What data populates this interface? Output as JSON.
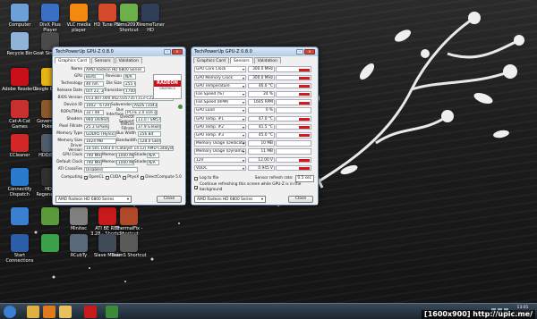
{
  "desktop_icons": [
    {
      "label": "Computer",
      "icon": "computer-icon",
      "color": "#6ea0d8"
    },
    {
      "label": "DivX Plus Player",
      "icon": "divx-icon",
      "color": "#3a6fc4"
    },
    {
      "label": "VLC media player",
      "icon": "vlc-icon",
      "color": "#f28a12"
    },
    {
      "label": "HD Tune Pro",
      "icon": "hdtune-icon",
      "color": "#d44a2a"
    },
    {
      "label": "Sims2097 - Shortcut",
      "icon": "sims-icon",
      "color": "#6bb04a"
    },
    {
      "label": "XtremeTuner HD",
      "icon": "xtremetuner-icon",
      "color": "#2f3f58"
    },
    {
      "label": "Recycle Bin",
      "icon": "recycle-bin-icon",
      "color": "#8fb4d8"
    },
    {
      "label": "Goat Simulator",
      "icon": "goat-icon",
      "color": "#4a4a4a"
    },
    {
      "label": "Adobe Reader 9",
      "icon": "adobe-reader-icon",
      "color": "#c8101a"
    },
    {
      "label": "Google Chrome",
      "icon": "chrome-icon",
      "color": "#e7b416"
    },
    {
      "label": "Cat-A-Cat Games",
      "icon": "cat-games-icon",
      "color": "#c83030"
    },
    {
      "label": "Governor of Poker 2",
      "icon": "poker-icon",
      "color": "#8a5a2a"
    },
    {
      "label": "CCleaner",
      "icon": "ccleaner-icon",
      "color": "#d02828"
    },
    {
      "label": "HDD/Deck",
      "icon": "hdd-icon",
      "color": "#505c6a"
    },
    {
      "label": "ConnectIfy Dispatch",
      "icon": "connectify-icon",
      "color": "#2a7bd0"
    },
    {
      "label": "HDD Regenerator",
      "icon": "hdd-regenerator-icon",
      "color": "#303030"
    },
    {
      "label": "",
      "icon": "app-icon",
      "color": "#3a7fd0"
    },
    {
      "label": "",
      "icon": "app-icon",
      "color": "#5a9a3a"
    },
    {
      "label": "Minitec",
      "icon": "minitec-icon",
      "color": "#808080"
    },
    {
      "label": "ATI BE RBE 3.28 - Shortcut",
      "icon": "ati-icon",
      "color": "#c81a1a"
    },
    {
      "label": "ThermalFix - Shortcut",
      "icon": "thermal-icon",
      "color": "#b04a2a"
    },
    {
      "label": "Start Connections",
      "icon": "network-icon",
      "color": "#2a5fa8"
    },
    {
      "label": "",
      "icon": "app-icon",
      "color": "#3aa04a"
    },
    {
      "label": "RCubTy",
      "icon": "rcub-icon",
      "color": "#5a6a7a"
    },
    {
      "label": "Slave Movie",
      "icon": "slave-movie-icon",
      "color": "#404a58"
    },
    {
      "label": "TeamS Shortcut",
      "icon": "teams-icon",
      "color": "#5a5a5a"
    }
  ],
  "window1": {
    "title": "TechPowerUp GPU-Z 0.8.0",
    "tabs": [
      "Graphics Card",
      "Sensors",
      "Validation"
    ],
    "active_tab": 0,
    "fields": {
      "name": "AMD Radeon HD 6800 Series",
      "gpu": "Barts",
      "revision": "N/A",
      "technology": "40 nm",
      "die_size": "255 mm²",
      "release_date": "Oct 22, 2010",
      "transistors": "1700M",
      "bios_version": "013.007.000.002.035735 (113-C2230100-102)",
      "device_id": "1002 - 6739",
      "subvendor": "ASUS (1043)",
      "rops_tmus": "32 / 48",
      "bus_interface": "PCI-E 2.0 x16 @ x16 1.1",
      "shaders": "960 Unified",
      "directx_support": "11.0 / SM5.0",
      "pixel_fillrate": "25.3 GPixel/s",
      "texture_fillrate": "37.9 GTexel/s",
      "memory_type": "GDDR5 (Hynix)",
      "bus_width": "256 Bit",
      "memory_size": "1024 MB",
      "bandwidth": "128.0 GB/s",
      "driver_version": "14.501.1003.0 (Catalyst 14.12) AMD Catalyst Omega Software",
      "gpu_clock": "790 MHz",
      "memory_clock": "1000 MHz",
      "shader_clock": "N/A",
      "default_clock": "790 MHz",
      "default_memory": "1000 MHz",
      "default_shader": "N/A",
      "crossfire": "Disabled",
      "computing": [
        "OpenCL",
        "CUDA",
        "PhysX",
        "DirectCompute 5.0"
      ],
      "computing_checked": [
        true,
        false,
        false,
        true
      ]
    },
    "labels": {
      "name": "Name",
      "gpu": "GPU",
      "revision": "Revision",
      "technology": "Technology",
      "die_size": "Die Size",
      "release_date": "Release Date",
      "transistors": "Transistors",
      "bios_version": "BIOS Version",
      "device_id": "Device ID",
      "subvendor": "Subvendor",
      "rops_tmus": "ROPs/TMUs",
      "bus_interface": "Bus Interface",
      "shaders": "Shaders",
      "directx_support": "DirectX Support",
      "pixel_fillrate": "Pixel Fillrate",
      "texture_fillrate": "Texture Fillrate",
      "memory_type": "Memory Type",
      "bus_width": "Bus Width",
      "memory_size": "Memory Size",
      "bandwidth": "Bandwidth",
      "driver_version": "Driver Version",
      "gpu_clock": "GPU Clock",
      "memory": "Memory",
      "shader": "Shader",
      "default_clock": "Default Clock",
      "crossfire": "ATI CrossFire",
      "computing": "Computing"
    },
    "logo_text": "RADEON",
    "logo_sub": "GRAPHICS",
    "card_select": "AMD Radeon HD 6800 Series",
    "close_label": "Close"
  },
  "window2": {
    "title": "TechPowerUp GPU-Z 0.8.0",
    "tabs": [
      "Graphics Card",
      "Sensors",
      "Validation"
    ],
    "active_tab": 1,
    "sensors": [
      {
        "name": "GPU Core Clock",
        "value": "300.0 MHz",
        "fill": 0.3
      },
      {
        "name": "GPU Memory Clock",
        "value": "300.0 MHz",
        "fill": 0.3
      },
      {
        "name": "GPU Temperature",
        "value": "46.0 °C",
        "fill": 0.3
      },
      {
        "name": "Fan Speed (%)",
        "value": "24 %",
        "fill": 0.3
      },
      {
        "name": "Fan Speed (RPM)",
        "value": "1605 RPM",
        "fill": 0.3
      },
      {
        "name": "GPU Load",
        "value": "0 %",
        "fill": 0.0
      },
      {
        "name": "GPU Temp. #1",
        "value": "47.0 °C",
        "fill": 0.3
      },
      {
        "name": "GPU Temp. #2",
        "value": "41.5 °C",
        "fill": 0.3
      },
      {
        "name": "GPU Temp. #3",
        "value": "45.0 °C",
        "fill": 0.3
      },
      {
        "name": "Memory Usage (Dedicated)",
        "value": "10 MB",
        "fill": 0.0
      },
      {
        "name": "Memory Usage (Dynamic)",
        "value": "11 MB",
        "fill": 0.0
      },
      {
        "name": "12V",
        "value": "12.00 V",
        "fill": 0.3
      },
      {
        "name": "VDDC",
        "value": "0.945 V",
        "fill": 0.3
      }
    ],
    "log_to_file": "Log to file",
    "refresh_label": "Sensor refresh rate:",
    "refresh_value": "0.5 sec",
    "continue_label": "Continue refreshing this screen while GPU-Z is in the background",
    "card_select": "AMD Radeon HD 6800 Series",
    "close_label": "Close"
  },
  "taskbar": {
    "apps": [
      {
        "icon": "start-orb-icon",
        "color": "#3a7fd0"
      },
      {
        "icon": "explorer-icon",
        "color": "#e0b040"
      },
      {
        "icon": "media-player-icon",
        "color": "#e07a1a"
      },
      {
        "icon": "folder-icon",
        "color": "#e8c060"
      },
      {
        "icon": "opera-icon",
        "color": "#c81a1a"
      },
      {
        "icon": "gpuz-icon",
        "color": "#3a8a3a"
      }
    ],
    "clock_time": "13:01",
    "clock_date": "16/4/2558"
  },
  "watermark": "[1600x900] http://upic.me/"
}
